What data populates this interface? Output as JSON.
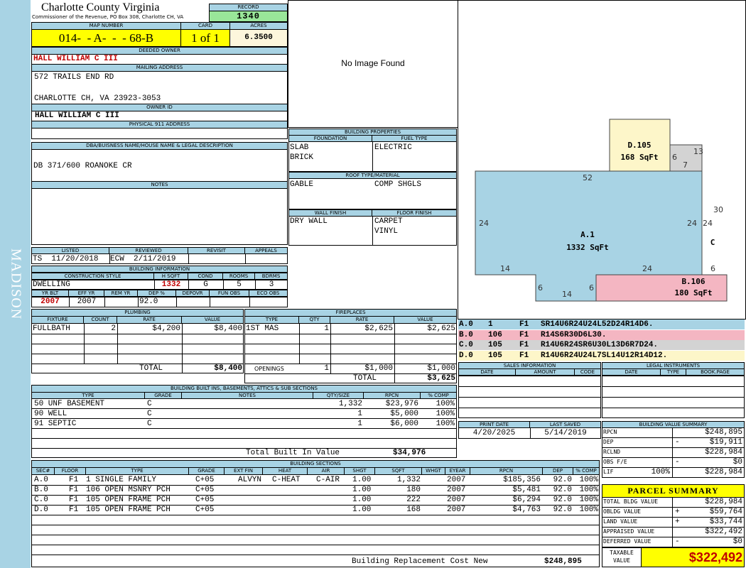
{
  "sidebar": {
    "label": "MADISON"
  },
  "header": {
    "county": "Charlotte County Virginia",
    "commissioner": "Commissioner of the Revenue, PO Box 308, Charlotte CH, VA",
    "record_label": "RECORD",
    "record": "1340",
    "map_number_label": "MAP NUMBER",
    "map_number": "014-  - A-  -  - 68-B",
    "card_label": "CARD",
    "card": "1 of 1",
    "acres_label": "ACRES",
    "acres": "6.3500"
  },
  "owner": {
    "deeded_label": "DEEDED OWNER",
    "deeded": "HALL WILLIAM C III",
    "mailing_label": "MAILING ADDRESS",
    "mail1": "572 TRAILS END RD",
    "mail2": "CHARLOTTE CH, VA 23923-3053",
    "owner_id_label": "OWNER ID",
    "owner_id": "HALL WILLIAM C III",
    "physical_label": "PHYSICAL 911 ADDRESS",
    "physical": "",
    "dba_label": "DBA/BUISNESS NAME/HOUSE NAME & LEGAL DESCRIPTION",
    "dba": "DB 371/600 ROANOKE CR",
    "notes_label": "NOTES",
    "notes": ""
  },
  "image_placeholder": "No Image Found",
  "listing": {
    "listed_label": "LISTED",
    "listed": "TS  11/20/2018",
    "reviewed_label": "REVIEWED",
    "reviewed": "ECW  2/11/2019",
    "revisit_label": "REVISIT",
    "revisit": "",
    "appeals_label": "APPEALS",
    "appeals": ""
  },
  "building_info": {
    "title": "BUILDING INFORMATION",
    "style_label": "CONSTRUCTION STYLE",
    "style": "DWELLING",
    "hsqft_label": "H SQFT",
    "hsqft": "1332",
    "cond_label": "COND",
    "cond": "G",
    "rooms_label": "ROOMS",
    "rooms": "5",
    "bdrms_label": "BDRMS",
    "bdrms": "3",
    "yrblt_label": "YR BLT",
    "yrblt": "2007",
    "effyr_label": "EFF YR",
    "effyr": "2007",
    "remyr_label": "REM YR",
    "remyr": "",
    "dep_label": "DEP %",
    "dep": "92.0",
    "depovr_label": "DEPOVR",
    "depovr": "",
    "funobs_label": "FUN OBS",
    "funobs": "",
    "ecoobs_label": "ECO OBS",
    "ecoobs": ""
  },
  "building_props": {
    "title": "BUILDING PROPERTIES",
    "foundation_label": "FOUNDATION",
    "foundation1": "SLAB",
    "foundation2": "BRICK",
    "fuel_label": "FUEL TYPE",
    "fuel": "ELECTRIC",
    "roof_label": "ROOF TYPE/MATERIAL",
    "roof1": "GABLE",
    "roof2": "COMP SHGLS",
    "wall_label": "WALL FINISH",
    "wall": "DRY WALL",
    "floor_label": "FLOOR FINISH",
    "floor1": "CARPET",
    "floor2": "VINYL"
  },
  "plumbing": {
    "title": "PLUMBING",
    "col_fixture": "FIXTURE",
    "col_count": "COUNT",
    "col_rate": "RATE",
    "col_value": "VALUE",
    "rows": [
      {
        "fixture": "FULLBATH",
        "count": "2",
        "rate": "$4,200",
        "value": "$8,400"
      }
    ],
    "total_label": "TOTAL",
    "total": "$8,400"
  },
  "fireplaces": {
    "title": "FIREPLACES",
    "col_type": "TYPE",
    "col_qty": "QTY",
    "col_rate": "RATE",
    "col_value": "VALUE",
    "rows": [
      {
        "type": "1ST MAS",
        "qty": "1",
        "rate": "$2,625",
        "value": "$2,625"
      }
    ],
    "openings_label": "OPENINGS",
    "openings_qty": "1",
    "openings_rate": "$1,000",
    "openings_value": "$1,000",
    "total_label": "TOTAL",
    "total": "$3,625"
  },
  "builtins": {
    "title": "BUILDING BUILT INS, BASEMENTS, ATTICS & SUB SECTIONS",
    "col_type": "TYPE",
    "col_grade": "GRADE",
    "col_notes": "NOTES",
    "col_qty": "QTY/SIZE",
    "col_rpcn": "RPCN",
    "col_comp": "% COMP",
    "rows": [
      {
        "type": "50 UNF BASEMENT",
        "grade": "C",
        "qty": "1,332",
        "rpcn": "$23,976",
        "comp": "100%"
      },
      {
        "type": "90 WELL",
        "grade": "C",
        "qty": "1",
        "rpcn": "$5,000",
        "comp": "100%"
      },
      {
        "type": "91 SEPTIC",
        "grade": "C",
        "qty": "1",
        "rpcn": "$6,000",
        "comp": "100%"
      }
    ],
    "total_label": "Total Built In Value",
    "total": "$34,976"
  },
  "sections": {
    "title": "BUILDING SECTIONS",
    "cols": {
      "sec": "SEC#",
      "floor": "FLOOR",
      "type": "TYPE",
      "grade": "GRADE",
      "extfin": "EXT FIN",
      "heat": "HEAT",
      "air": "AIR",
      "shgt": "SHGT",
      "sqft": "SQFT",
      "whgt": "WHGT",
      "eyear": "EYEAR",
      "rpcn": "RPCN",
      "dep": "DEP",
      "comp": "% COMP"
    },
    "rows": [
      {
        "sec": "A.0",
        "floor": "F1",
        "type": "1 SINGLE FAMILY",
        "grade": "C+05",
        "extfin": "ALVYN",
        "heat": "C-HEAT",
        "air": "C-AIR",
        "shgt": "1.00",
        "sqft": "1,332",
        "eyear": "2007",
        "rpcn": "$185,356",
        "dep": "92.0",
        "comp": "100%"
      },
      {
        "sec": "B.0",
        "floor": "F1",
        "type": "106 OPEN MSNRY PCH",
        "grade": "C+05",
        "extfin": "",
        "heat": "",
        "air": "",
        "shgt": "1.00",
        "sqft": "180",
        "eyear": "2007",
        "rpcn": "$5,481",
        "dep": "92.0",
        "comp": "100%"
      },
      {
        "sec": "C.0",
        "floor": "F1",
        "type": "105 OPEN FRAME PCH",
        "grade": "C+05",
        "extfin": "",
        "heat": "",
        "air": "",
        "shgt": "1.00",
        "sqft": "222",
        "eyear": "2007",
        "rpcn": "$6,294",
        "dep": "92.0",
        "comp": "100%"
      },
      {
        "sec": "D.0",
        "floor": "F1",
        "type": "105 OPEN FRAME PCH",
        "grade": "C+05",
        "extfin": "",
        "heat": "",
        "air": "",
        "shgt": "1.00",
        "sqft": "168",
        "eyear": "2007",
        "rpcn": "$4,763",
        "dep": "92.0",
        "comp": "100%"
      }
    ],
    "total_label": "Building Replacement Cost New",
    "total": "$248,895"
  },
  "sketch": {
    "A": {
      "name": "A.1",
      "area": "1332 SqFt"
    },
    "B": {
      "name": "B.106",
      "area": "180 SqFt"
    },
    "C": {
      "name": "C"
    },
    "D": {
      "name": "D.105",
      "area": "168 SqFt"
    },
    "dims": {
      "a_top": "52",
      "a_left": "24",
      "a_right": "24",
      "a_bot_left": "14",
      "a_bot_right": "24",
      "notch_left": "6",
      "notch_bot": "14",
      "notch_right": "6",
      "c_left": "24",
      "c_right": "30",
      "c_top": "13",
      "c_bot": "6",
      "d_right": "6",
      "d_7": "7"
    },
    "colors": {
      "A": "#a8d3e4",
      "B": "#f4b6c2",
      "C": "#d3d3d3",
      "D": "#fdf6c9"
    }
  },
  "sketch_legend": [
    {
      "sec": "A.0",
      "code": "1",
      "floor": "F1",
      "desc": "SR14U6R24U24L52D24R14D6.",
      "color": "#a8d3e4"
    },
    {
      "sec": "B.0",
      "code": "106",
      "floor": "F1",
      "desc": "R14S6R30D6L30.",
      "color": "#f4b6c2"
    },
    {
      "sec": "C.0",
      "code": "105",
      "floor": "F1",
      "desc": "R14U6R24SR6U30L13D6R7D24.",
      "color": "#d3d3d3"
    },
    {
      "sec": "D.0",
      "code": "105",
      "floor": "F1",
      "desc": "R14U6R24U24L7SL14U12R14D12.",
      "color": "#fdf6c9"
    }
  ],
  "sales": {
    "title": "SALES INFORMATION",
    "col_date": "DATE",
    "col_amount": "AMOUNT",
    "col_code": "CODE"
  },
  "legal": {
    "title": "LEGAL INSTRUMENTS",
    "col_date": "DATE",
    "col_type": "TYPE",
    "col_book": "BOOK.PAGE"
  },
  "print": {
    "print_label": "PRINT DATE",
    "print_date": "4/20/2025",
    "saved_label": "LAST SAVED",
    "saved_date": "5/14/2019"
  },
  "value_summary": {
    "title": "BUILDING VALUE SUMMARY",
    "rows": [
      {
        "label": "RPCN",
        "sign": "",
        "value": "$248,895"
      },
      {
        "label": "DEP",
        "sign": "-",
        "value": "$19,911"
      },
      {
        "label": "RCLND",
        "sign": "",
        "value": "$228,984"
      },
      {
        "label": "OBS F/E",
        "sign": "-",
        "value": "$0"
      },
      {
        "label": "LIF",
        "pct": "100%",
        "sign": "",
        "value": "$228,984"
      }
    ]
  },
  "parcel": {
    "title": "PARCEL SUMMARY",
    "rows": [
      {
        "label": "TOTAL BLDG VALUE",
        "sign": "",
        "value": "$228,984"
      },
      {
        "label": "OBLDG VALUE",
        "sign": "+",
        "value": "$59,764"
      },
      {
        "label": "LAND VALUE",
        "sign": "+",
        "value": "$33,744"
      },
      {
        "label": "APPRAISED VALUE",
        "sign": "",
        "value": "$322,492"
      },
      {
        "label": "DEFERRED VALUE",
        "sign": "-",
        "value": "$0"
      }
    ],
    "taxable_label1": "TAXABLE",
    "taxable_label2": "VALUE",
    "taxable": "$322,492",
    "colors": {
      "accent": "#ffff00",
      "taxable": "#c00000"
    }
  }
}
